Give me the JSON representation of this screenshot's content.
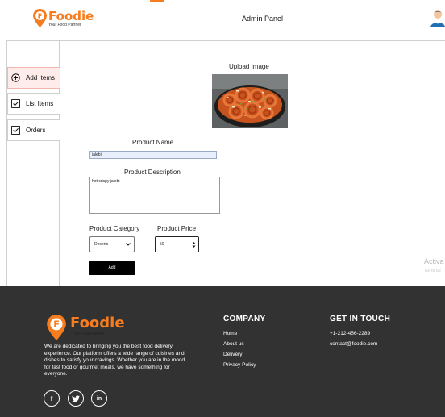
{
  "header": {
    "brand": "Foodie",
    "tagline": "Your Food Partner",
    "title": "Admin Panel"
  },
  "sidebar": {
    "items": [
      {
        "label": "Add Items",
        "icon": "plus-circle-icon"
      },
      {
        "label": "List Items",
        "icon": "checkbox-icon"
      },
      {
        "label": "Orders",
        "icon": "checkbox-icon"
      }
    ]
  },
  "form": {
    "upload_label": "Upload Image",
    "name_label": "Product Name",
    "name_value": "jalebi",
    "desc_label": "Product Description",
    "desc_value": "hot crispy jalebi",
    "category_label": "Product Category",
    "category_value": "Deserts",
    "price_label": "Product Price",
    "price_value": "50",
    "add_label": "Add"
  },
  "watermark": {
    "title": "Activa",
    "subtitle": "Go to Se"
  },
  "footer": {
    "brand": "Foodie",
    "tagline": "Your Food Partner",
    "about": "We are dedicated to bringing you the best food delivery experience. Our platform offers a wide range of cuisines and dishes to satisfy your cravings. Whether you are in the mood for fast food or gourmet meals, we have something for everyone.",
    "company_title": "COMPANY",
    "company_links": [
      "Home",
      "About us",
      "Delivery",
      "Privacy Policy"
    ],
    "contact_title": "GET IN TOUCH",
    "phone": "+1-212-456-2289",
    "email": "contact@foodie.com",
    "social": [
      {
        "icon": "facebook-icon",
        "glyph": "f"
      },
      {
        "icon": "twitter-icon",
        "glyph": ""
      },
      {
        "icon": "linkedin-icon",
        "glyph": "in"
      }
    ]
  },
  "colors": {
    "brand_orange": "#f57c1f",
    "footer_bg": "#323232",
    "active_tab_bg": "#fdecea"
  }
}
